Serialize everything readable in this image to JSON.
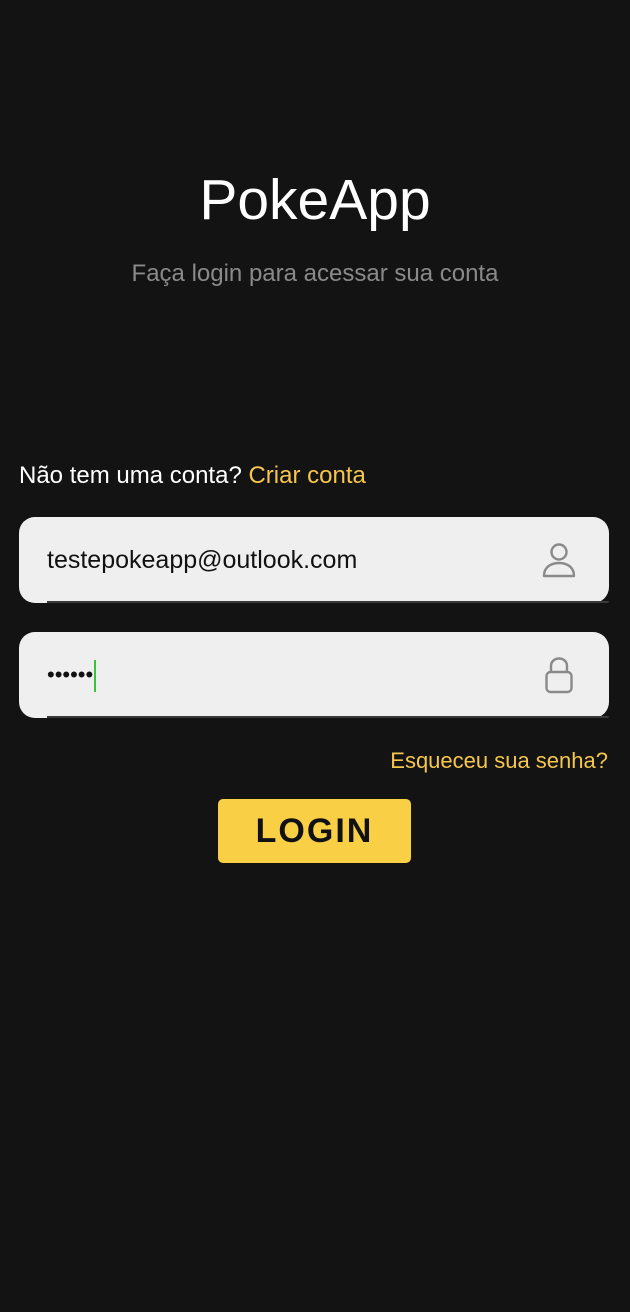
{
  "header": {
    "title": "PokeApp",
    "subtitle": "Faça login para acessar sua conta"
  },
  "signup": {
    "prompt": "Não tem uma conta?",
    "link_label": "Criar conta"
  },
  "email_field": {
    "value": "testepokeapp@outlook.com",
    "icon": "user-icon"
  },
  "password_field": {
    "value": "••••••",
    "icon": "lock-icon"
  },
  "forgot_password": {
    "label": "Esqueceu sua senha?"
  },
  "login_button": {
    "label": "LOGIN"
  },
  "colors": {
    "background": "#131313",
    "accent": "#f6c64d",
    "button": "#f8cf45",
    "field_background": "#efefef",
    "caret": "#3fbf3f"
  }
}
